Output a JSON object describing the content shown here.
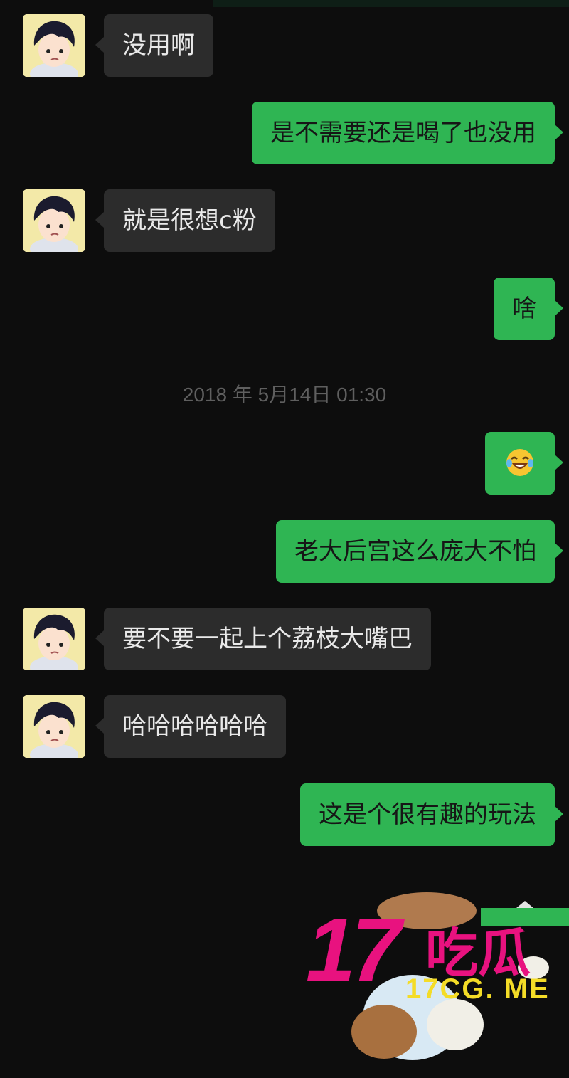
{
  "messages": [
    {
      "side": "in",
      "text": "没用啊"
    },
    {
      "side": "out",
      "text": "是不需要还是喝了也没用"
    },
    {
      "side": "in",
      "text": "就是很想c粉"
    },
    {
      "side": "out",
      "text": "啥"
    },
    {
      "side": "out",
      "text": "",
      "emoji": "laughing-tears-emoji"
    },
    {
      "side": "out",
      "text": "老大后宫这么庞大不怕"
    },
    {
      "side": "in",
      "text": "要不要一起上个荔枝大嘴巴"
    },
    {
      "side": "in",
      "text": "哈哈哈哈哈哈"
    },
    {
      "side": "out",
      "text": "这是个很有趣的玩法"
    }
  ],
  "timestamp": "2018 年 5月14日 01:30",
  "watermark": {
    "number": "17",
    "cn": "吃瓜",
    "url": "17CG. ME"
  },
  "colors": {
    "background": "#0d0d0d",
    "incoming_bubble": "#2c2c2c",
    "outgoing_bubble": "#2fb553",
    "watermark_pink": "#e8127f",
    "watermark_yellow": "#f4dc27"
  }
}
